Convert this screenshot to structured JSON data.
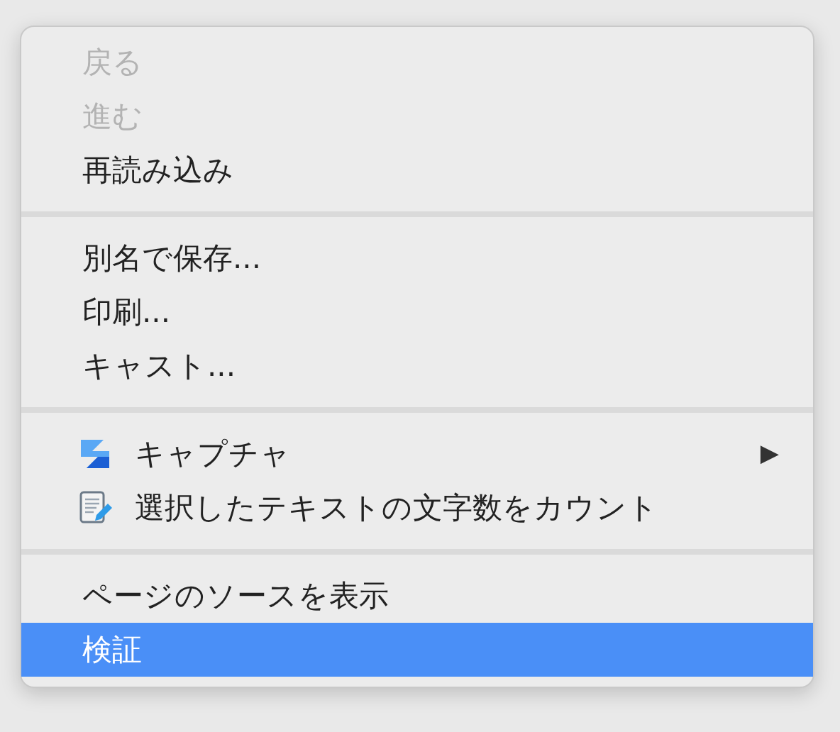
{
  "menu": {
    "sections": [
      {
        "items": [
          {
            "label": "戻る",
            "disabled": true,
            "selected": false
          },
          {
            "label": "進む",
            "disabled": true,
            "selected": false
          },
          {
            "label": "再読み込み",
            "disabled": false,
            "selected": false
          }
        ]
      },
      {
        "items": [
          {
            "label": "別名で保存...",
            "disabled": false,
            "selected": false
          },
          {
            "label": "印刷...",
            "disabled": false,
            "selected": false
          },
          {
            "label": "キャスト...",
            "disabled": false,
            "selected": false
          }
        ]
      },
      {
        "items": [
          {
            "label": "キャプチャ",
            "disabled": false,
            "selected": false,
            "kind": "logo",
            "submenu_arrow": "▶"
          },
          {
            "label": "選択したテキストの文字数をカウント",
            "disabled": false,
            "selected": false,
            "kind": "note"
          }
        ]
      },
      {
        "items": [
          {
            "label": "ページのソースを表示",
            "disabled": false,
            "selected": false
          },
          {
            "label": "検証",
            "disabled": false,
            "selected": true
          }
        ]
      }
    ]
  }
}
